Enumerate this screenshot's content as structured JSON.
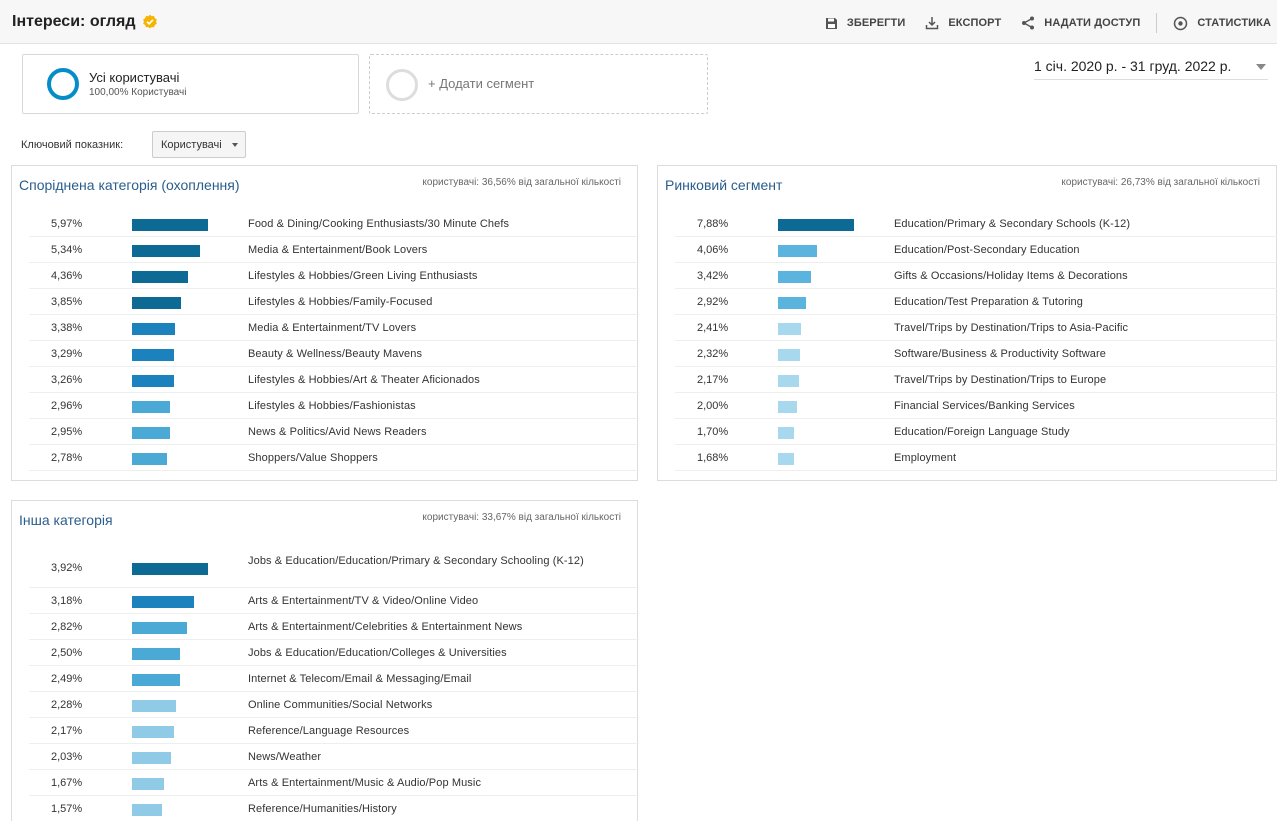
{
  "header": {
    "title": "Інтереси: огляд",
    "save": "ЗБЕРЕГТИ",
    "export": "ЕКСПОРТ",
    "share": "НАДАТИ ДОСТУП",
    "insights": "СТАТИСТИКА"
  },
  "segments": {
    "all_users": {
      "name": "Усі користувачі",
      "sub": "100,00% Користувачі"
    },
    "add_label": "+ Додати сегмент"
  },
  "date_range": "1 січ. 2020 р. - 31 груд. 2022 р.",
  "metric": {
    "label": "Ключовий показник:",
    "value": "Користувачі"
  },
  "colors": {
    "bar_dark": "#0d6a94",
    "bar_mid": "#1a8ac8",
    "bar_light": "#8fcbe6",
    "title_blue": "#2a5d8c"
  },
  "icons": {
    "save": "floppy-disk-icon",
    "export": "download-icon",
    "share": "share-icon",
    "insights": "insights-icon",
    "verified": "verified-badge-icon"
  },
  "cards": [
    {
      "title": "Споріднена категорія (охоплення)",
      "note": "користувачі: 36,56% від загальної кількості",
      "rows": [
        {
          "pct": "5,97%",
          "value": 5.97,
          "label": "Food & Dining/Cooking Enthusiasts/30 Minute Chefs"
        },
        {
          "pct": "5,34%",
          "value": 5.34,
          "label": "Media & Entertainment/Book Lovers"
        },
        {
          "pct": "4,36%",
          "value": 4.36,
          "label": "Lifestyles & Hobbies/Green Living Enthusiasts"
        },
        {
          "pct": "3,85%",
          "value": 3.85,
          "label": "Lifestyles & Hobbies/Family-Focused"
        },
        {
          "pct": "3,38%",
          "value": 3.38,
          "label": "Media & Entertainment/TV Lovers"
        },
        {
          "pct": "3,29%",
          "value": 3.29,
          "label": "Beauty & Wellness/Beauty Mavens"
        },
        {
          "pct": "3,26%",
          "value": 3.26,
          "label": "Lifestyles & Hobbies/Art & Theater Aficionados"
        },
        {
          "pct": "2,96%",
          "value": 2.96,
          "label": "Lifestyles & Hobbies/Fashionistas"
        },
        {
          "pct": "2,95%",
          "value": 2.95,
          "label": "News & Politics/Avid News Readers"
        },
        {
          "pct": "2,78%",
          "value": 2.78,
          "label": "Shoppers/Value Shoppers"
        }
      ]
    },
    {
      "title": "Ринковий сегмент",
      "note": "користувачі: 26,73% від загальної кількості",
      "rows": [
        {
          "pct": "7,88%",
          "value": 7.88,
          "label": "Education/Primary & Secondary Schools (K-12)"
        },
        {
          "pct": "4,06%",
          "value": 4.06,
          "label": "Education/Post-Secondary Education"
        },
        {
          "pct": "3,42%",
          "value": 3.42,
          "label": "Gifts & Occasions/Holiday Items & Decorations"
        },
        {
          "pct": "2,92%",
          "value": 2.92,
          "label": "Education/Test Preparation & Tutoring"
        },
        {
          "pct": "2,41%",
          "value": 2.41,
          "label": "Travel/Trips by Destination/Trips to Asia-Pacific"
        },
        {
          "pct": "2,32%",
          "value": 2.32,
          "label": "Software/Business & Productivity Software"
        },
        {
          "pct": "2,17%",
          "value": 2.17,
          "label": "Travel/Trips by Destination/Trips to Europe"
        },
        {
          "pct": "2,00%",
          "value": 2.0,
          "label": "Financial Services/Banking Services"
        },
        {
          "pct": "1,70%",
          "value": 1.7,
          "label": "Education/Foreign Language Study"
        },
        {
          "pct": "1,68%",
          "value": 1.68,
          "label": "Employment"
        }
      ]
    },
    {
      "title": "Інша категорія",
      "note": "користувачі: 33,67% від загальної кількості",
      "rows": [
        {
          "pct": "3,92%",
          "value": 3.92,
          "label": "Jobs & Education/Education/Primary & Secondary Schooling (K-12)"
        },
        {
          "pct": "3,18%",
          "value": 3.18,
          "label": "Arts & Entertainment/TV & Video/Online Video"
        },
        {
          "pct": "2,82%",
          "value": 2.82,
          "label": "Arts & Entertainment/Celebrities & Entertainment News"
        },
        {
          "pct": "2,50%",
          "value": 2.5,
          "label": "Jobs & Education/Education/Colleges & Universities"
        },
        {
          "pct": "2,49%",
          "value": 2.49,
          "label": "Internet & Telecom/Email & Messaging/Email"
        },
        {
          "pct": "2,28%",
          "value": 2.28,
          "label": "Online Communities/Social Networks"
        },
        {
          "pct": "2,17%",
          "value": 2.17,
          "label": "Reference/Language Resources"
        },
        {
          "pct": "2,03%",
          "value": 2.03,
          "label": "News/Weather"
        },
        {
          "pct": "1,67%",
          "value": 1.67,
          "label": "Arts & Entertainment/Music & Audio/Pop Music"
        },
        {
          "pct": "1,57%",
          "value": 1.57,
          "label": "Reference/Humanities/History"
        }
      ]
    }
  ]
}
